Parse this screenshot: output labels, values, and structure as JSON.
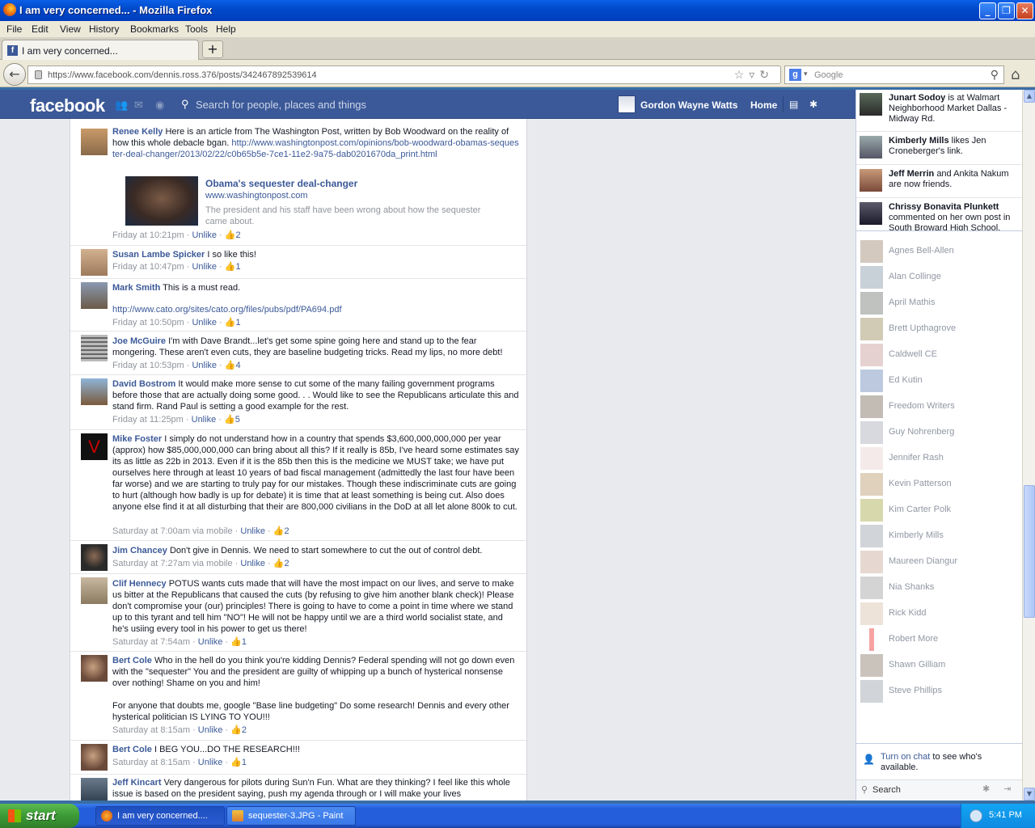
{
  "window": {
    "title": "I am very concerned... - Mozilla Firefox"
  },
  "menu": [
    "File",
    "Edit",
    "View",
    "History",
    "Bookmarks",
    "Tools",
    "Help"
  ],
  "tab": {
    "label": "I am very concerned...",
    "new_tab": "+"
  },
  "nav": {
    "url": "https://www.facebook.com/dennis.ross.376/posts/342467892539614",
    "search_placeholder": "Google"
  },
  "fb": {
    "logo": "facebook",
    "search_placeholder": "Search for people, places and things",
    "user_name": "Gordon Wayne Watts",
    "home": "Home"
  },
  "comments": [
    {
      "author": "Renee Kelly",
      "text": "Here is an article from The Washington Post, written by Bob Woodward on the reality of how this whole debacle bgan.",
      "link": "http://www.washingtonpost.com/opinions/bob-woodward-obamas-sequester-deal-changer/2013/02/22/c0b65b5e-7ce1-11e2-9a75-dab0201670da_print.html",
      "time": "Friday at 10:21pm",
      "unlike": "Unlike",
      "likes": "2"
    },
    {
      "author": "Susan Lambe Spicker",
      "text": "I so like this!",
      "time": "Friday at 10:47pm",
      "unlike": "Unlike",
      "likes": "1"
    },
    {
      "author": "Mark Smith",
      "text": "This is a must read.",
      "link": "http://www.cato.org/sites/cato.org/files/pubs/pdf/PA694.pdf",
      "time": "Friday at 10:50pm",
      "unlike": "Unlike",
      "likes": "1"
    },
    {
      "author": "Joe McGuire",
      "text": "I'm with Dave Brandt...let's get some spine going here and stand up to the fear mongering. These aren't even cuts, they are baseline budgeting tricks. Read my lips, no more debt!",
      "time": "Friday at 10:53pm",
      "unlike": "Unlike",
      "likes": "4"
    },
    {
      "author": "David Bostrom",
      "text": "It would make more sense to cut some of the many failing government programs before those that are actually doing some good. . . Would like to see the Republicans articulate this and stand firm. Rand Paul is setting a good example for the rest.",
      "time": "Friday at 11:25pm",
      "unlike": "Unlike",
      "likes": "5"
    },
    {
      "author": "Mike Foster",
      "text": "I simply do not understand how in a country that spends $3,600,000,000,000 per year (approx) how $85,000,000,000 can bring about all this? If it really is 85b, I've heard some estimates say its as little as 22b in 2013. Even if it is the 85b then this is the medicine we MUST take; we have put ourselves here through at least 10 years of bad fiscal management (admittedly the last four have been far worse) and we are starting to truly pay for our mistakes. Though these indiscriminate cuts are going to hurt (although how badly is up for debate) it is time that at least something is being cut. Also does anyone else find it at all disturbing that their are 800,000 civilians in the DoD at all let alone 800k to cut.",
      "time": "Saturday at 7:00am via mobile",
      "unlike": "Unlike",
      "likes": "2"
    },
    {
      "author": "Jim Chancey",
      "text": "Don't give in Dennis. We need to start somewhere to cut the out of control debt.",
      "time": "Saturday at 7:27am via mobile",
      "unlike": "Unlike",
      "likes": "2"
    },
    {
      "author": "Clif Hennecy",
      "text": "POTUS wants cuts made that will have the most impact on our lives, and serve to make us bitter at the Republicans that caused the cuts (by refusing to give him another blank check)! Please don't compromise your (our) principles! There is going to have to come a point in time where we stand up to this tyrant and tell him \"NO\"! He will not be happy until we are a third world socialist state, and he's usiing every tool in his power to get us there!",
      "time": "Saturday at 7:54am",
      "unlike": "Unlike",
      "likes": "1"
    },
    {
      "author": "Bert Cole",
      "text": "Who in the hell do you think you're kidding Dennis? Federal spending will not go down even with the \"sequester\" You and the president are guilty of whipping up a bunch of hysterical nonsense over nothing! Shame on you and him!",
      "text2": "For anyone that doubts me, google \"Base line budgeting\" Do some research! Dennis and every other hysterical politician IS LYING TO YOU!!!",
      "time": "Saturday at 8:15am",
      "unlike": "Unlike",
      "likes": "2"
    },
    {
      "author": "Bert Cole",
      "text": "I BEG YOU...DO THE RESEARCH!!!",
      "time": "Saturday at 8:15am",
      "unlike": "Unlike",
      "likes": "1"
    },
    {
      "author": "Jeff Kincart",
      "text": "Very dangerous for pilots during Sun'n Fun. What are they thinking? I feel like this whole issue is based on the president saying, push my agenda through or I will make your lives"
    }
  ],
  "preview": {
    "title": "Obama's sequester deal-changer",
    "domain": "www.washingtonpost.com",
    "desc": "The president and his staff have been wrong about how the sequester came about."
  },
  "ticker": [
    {
      "name": "Junart Sodoy",
      "text": "is at Walmart Neighborhood Market Dallas - Midway Rd."
    },
    {
      "name": "Kimberly Mills",
      "text": "likes Jen Croneberger's link."
    },
    {
      "name": "Jeff Merrin",
      "text": "and Ankita Nakum are now friends."
    },
    {
      "name": "Chrissy Bonavita Plunkett",
      "text": "commented on her own post in South Broward High School."
    }
  ],
  "friends": [
    "Agnes Bell-Allen",
    "Alan Collinge",
    "April Mathis",
    "Brett Upthagrove",
    "Caldwell CE",
    "Ed Kutin",
    "Freedom Writers",
    "Guy Nohrenberg",
    "Jennifer Rash",
    "Kevin Patterson",
    "Kim Carter Polk",
    "Kimberly Mills",
    "Maureen Diangur",
    "Nia Shanks",
    "Rick Kidd",
    "Robert More",
    "Shawn Gilliam",
    "Steve Phillips"
  ],
  "chat": {
    "turn_on": "Turn on chat",
    "rest": " to see who's available.",
    "search": "Search"
  },
  "taskbar": {
    "start": "start",
    "task1": "I am very concerned....",
    "task2": "sequester-3.JPG - Paint",
    "clock": "5:41 PM"
  }
}
